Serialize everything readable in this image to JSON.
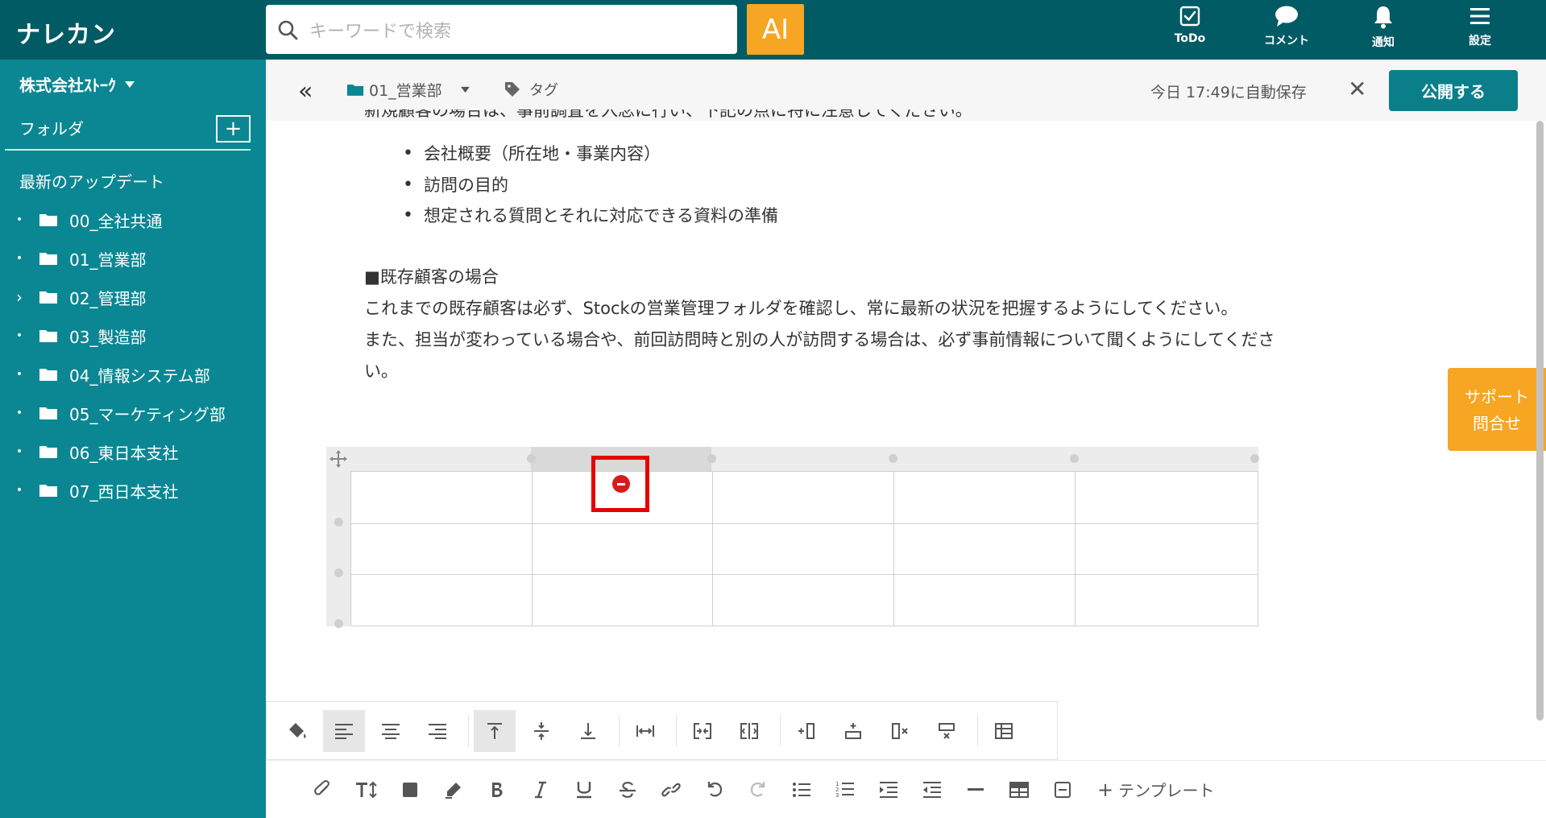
{
  "app": {
    "logo": "ナレカン"
  },
  "search": {
    "placeholder": "キーワードで検索"
  },
  "ai_button": {
    "label": "AI"
  },
  "header_nav": [
    {
      "label": "ToDo",
      "icon": "todo-icon"
    },
    {
      "label": "コメント",
      "icon": "comment-icon"
    },
    {
      "label": "通知",
      "icon": "bell-icon"
    },
    {
      "label": "設定",
      "icon": "menu-icon"
    }
  ],
  "sidebar": {
    "company": "株式会社ｽﾄｰｸ",
    "folder_header": "フォルダ",
    "add_label": "+",
    "recent": "最新のアップデート",
    "folders": [
      {
        "name": "00_全社共通",
        "marker": "•"
      },
      {
        "name": "01_営業部",
        "marker": "•"
      },
      {
        "name": "02_管理部",
        "marker": "›"
      },
      {
        "name": "03_製造部",
        "marker": "•"
      },
      {
        "name": "04_情報システム部",
        "marker": "•"
      },
      {
        "name": "05_マーケティング部",
        "marker": "•"
      },
      {
        "name": "06_東日本支社",
        "marker": "•"
      },
      {
        "name": "07_西日本支社",
        "marker": "•"
      }
    ]
  },
  "doc_header": {
    "back": "«",
    "folder": "01_営業部",
    "tag": "タグ",
    "autosave": "今日 17:49に自動保存",
    "close": "✕",
    "publish": "公開する"
  },
  "content": {
    "cut_line": "新規顧客の場合は、事前調査を入念に行い、下記の点に特に注意してください。",
    "bullets": [
      "会社概要（所在地・事業内容）",
      "訪問の目的",
      "想定される質問とそれに対応できる資料の準備"
    ],
    "section_title": "■既存顧客の場合",
    "para1": "これまでの既存顧客は必ず、Stockの営業管理フォルダを確認し、常に最新の状況を把握するようにしてください。",
    "para2": "また、担当が変わっている場合や、前回訪問時と別の人が訪問する場合は、必ず事前情報について聞くようにしてくださ",
    "para3": "い。"
  },
  "support": {
    "line1": "サポート",
    "line2": "問合せ"
  },
  "bottom_toolbar": {
    "template": "テンプレート",
    "template_plus": "+"
  }
}
